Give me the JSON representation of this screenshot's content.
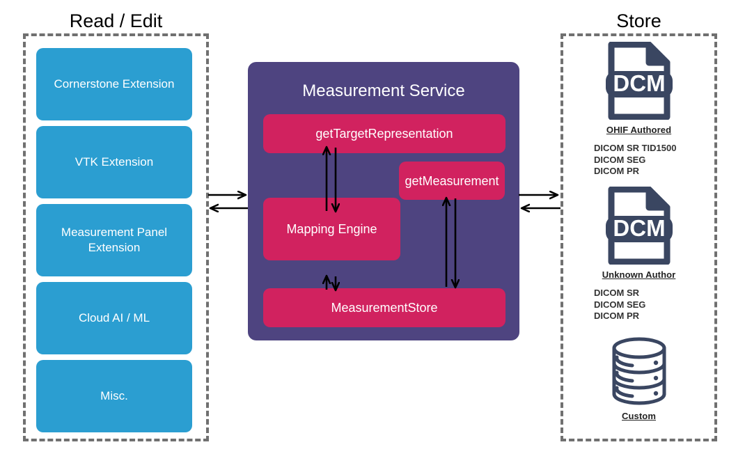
{
  "columns": {
    "left_title": "Read / Edit",
    "right_title": "Store"
  },
  "colors": {
    "extension_blue": "#2b9ed1",
    "service_purple": "#4e4480",
    "method_pink": "#d1225f",
    "icon_navy": "#3a4661",
    "dash_gray": "#707070"
  },
  "left_panel": {
    "extensions": [
      {
        "label": "Cornerstone Extension"
      },
      {
        "label": "VTK Extension"
      },
      {
        "label": "Measurement Panel Extension"
      },
      {
        "label": "Cloud AI / ML"
      },
      {
        "label": "Misc."
      }
    ]
  },
  "service": {
    "title": "Measurement Service",
    "boxes": {
      "target_representation": "getTargetRepresentation",
      "get_measurement": "getMeasurement",
      "mapping_engine": "Mapping Engine",
      "measurement_store": "MeasurementStore"
    }
  },
  "store_panel": {
    "items": [
      {
        "icon": "dcm-file-icon",
        "icon_text": "DCM",
        "label": "OHIF Authored",
        "formats": [
          "DICOM SR TID1500",
          "DICOM SEG",
          "DICOM PR"
        ]
      },
      {
        "icon": "dcm-file-icon",
        "icon_text": "DCM",
        "label": "Unknown Author",
        "formats": [
          "DICOM SR",
          "DICOM SEG",
          "DICOM PR"
        ]
      },
      {
        "icon": "database-cylinder-icon",
        "icon_text": "",
        "label": "Custom",
        "formats": []
      }
    ]
  },
  "connectors": {
    "left_to_service_out": "arrow-right",
    "left_to_service_in": "arrow-left",
    "service_to_store_out": "arrow-right",
    "service_to_store_in": "arrow-left",
    "target_mapping": "bidirectional-vertical",
    "mapping_store": "bidirectional-vertical-short",
    "getmeasurement_store": "bidirectional-vertical"
  }
}
